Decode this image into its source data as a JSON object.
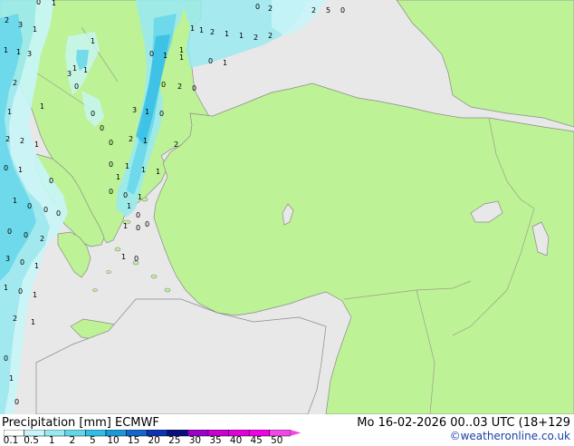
{
  "footer": {
    "title": "Precipitation [mm]  ECMWF",
    "datetime": "Mo 16-02-2026 00..03 UTC (18+129",
    "credit": "©weatheronline.co.uk"
  },
  "legend": {
    "ticks": [
      "0.1",
      "0.5",
      "1",
      "2",
      "5",
      "10",
      "15",
      "20",
      "25",
      "30",
      "35",
      "40",
      "45",
      "50"
    ],
    "colors": [
      "#ffffff",
      "#c8f5f8",
      "#9ae9f0",
      "#64d6ea",
      "#32bde6",
      "#1a98d8",
      "#1466c8",
      "#0c34b0",
      "#08107e",
      "#9a00c8",
      "#c800d0",
      "#e000d8",
      "#f000e4",
      "#f048e8"
    ]
  },
  "map_colors": {
    "land": "#bef296",
    "sea_land_outside": "#e8e8e8",
    "coast": "#8a8a8a",
    "border": "#9aa08a"
  },
  "precip_values": [
    "0",
    "1",
    "2",
    "3",
    "1",
    "1",
    "1",
    "2",
    "1",
    "1",
    "2",
    "2",
    "0",
    "2",
    "2",
    "5",
    "0",
    "1",
    "3",
    "1",
    "0",
    "1",
    "1",
    "0",
    "1",
    "2",
    "1",
    "1",
    "0",
    "2",
    "0",
    "1",
    "3",
    "1",
    "0",
    "2",
    "2",
    "1",
    "2",
    "1",
    "2",
    "0",
    "1",
    "0",
    "1",
    "1",
    "1",
    "0",
    "0",
    "0",
    "1",
    "1",
    "0",
    "0",
    "0",
    "1",
    "0",
    "0",
    "0",
    "2",
    "3",
    "0",
    "1",
    "1",
    "0",
    "1",
    "0",
    "1",
    "2",
    "1",
    "1",
    "0",
    "0",
    "3",
    "0",
    "1",
    "1",
    "1",
    "0",
    "0",
    "0",
    "1",
    "1",
    "0",
    "0"
  ]
}
